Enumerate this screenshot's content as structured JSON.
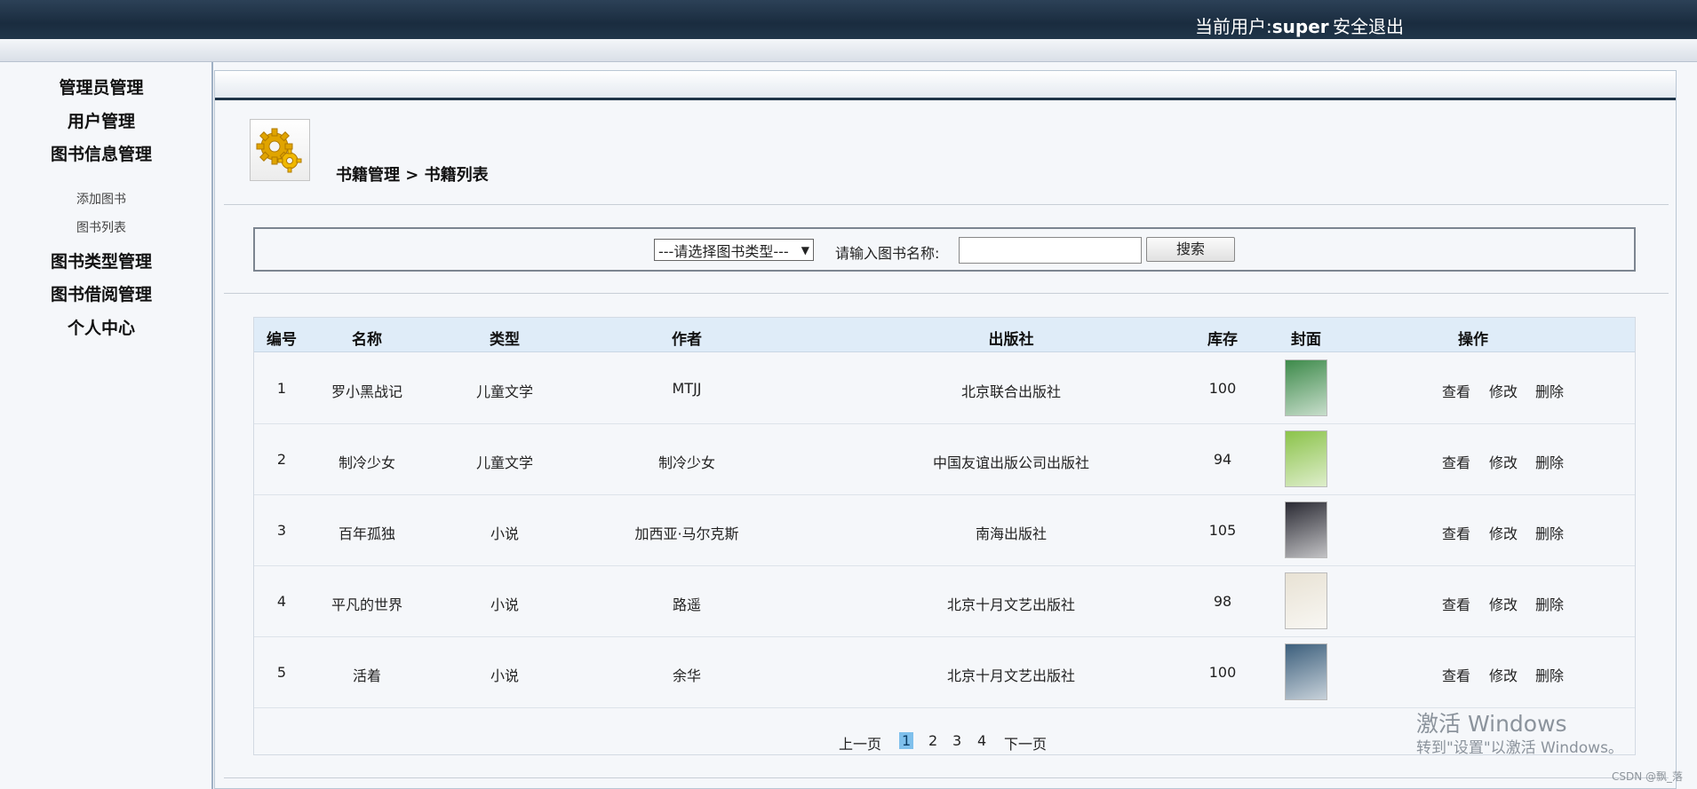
{
  "header": {
    "user_prefix": "当前用户:",
    "user_name": "super",
    "logout_label": "安全退出"
  },
  "sidebar": {
    "items": [
      {
        "label": "管理员管理"
      },
      {
        "label": "用户管理"
      },
      {
        "label": "图书信息管理"
      },
      {
        "label": "添加图书"
      },
      {
        "label": "图书列表"
      },
      {
        "label": "图书类型管理"
      },
      {
        "label": "图书借阅管理"
      },
      {
        "label": "个人中心"
      }
    ]
  },
  "breadcrumb": "书籍管理 > 书籍列表",
  "search": {
    "type_select": "---请选择图书类型---",
    "name_label": "请输入图书名称:",
    "name_value": "",
    "button_label": "搜索"
  },
  "table": {
    "headers": [
      "编号",
      "名称",
      "类型",
      "作者",
      "出版社",
      "库存",
      "封面",
      "操作"
    ],
    "rows": [
      {
        "id": "1",
        "name": "罗小黑战记",
        "type": "儿童文学",
        "author": "MTJJ",
        "publisher": "北京联合出版社",
        "stock": "100",
        "cover_color": "#3d8a4a"
      },
      {
        "id": "2",
        "name": "制冷少女",
        "type": "儿童文学",
        "author": "制冷少女",
        "publisher": "中国友谊出版公司出版社",
        "stock": "94",
        "cover_color": "#8bc34a"
      },
      {
        "id": "3",
        "name": "百年孤独",
        "type": "小说",
        "author": "加西亚·马尔克斯",
        "publisher": "南海出版社",
        "stock": "105",
        "cover_color": "#2a2a33"
      },
      {
        "id": "4",
        "name": "平凡的世界",
        "type": "小说",
        "author": "路遥",
        "publisher": "北京十月文艺出版社",
        "stock": "98",
        "cover_color": "#e8e2d4"
      },
      {
        "id": "5",
        "name": "活着",
        "type": "小说",
        "author": "余华",
        "publisher": "北京十月文艺出版社",
        "stock": "100",
        "cover_color": "#3c5f7c"
      }
    ],
    "actions": [
      "查看",
      "修改",
      "删除"
    ]
  },
  "pagination": {
    "prev": "上一页",
    "pages": [
      "1",
      "2",
      "3",
      "4"
    ],
    "current": "1",
    "next": "下一页"
  },
  "watermark": {
    "line1": "激活 Windows",
    "line2": "转到\"设置\"以激活 Windows。",
    "csdn": "CSDN @飘_落"
  }
}
